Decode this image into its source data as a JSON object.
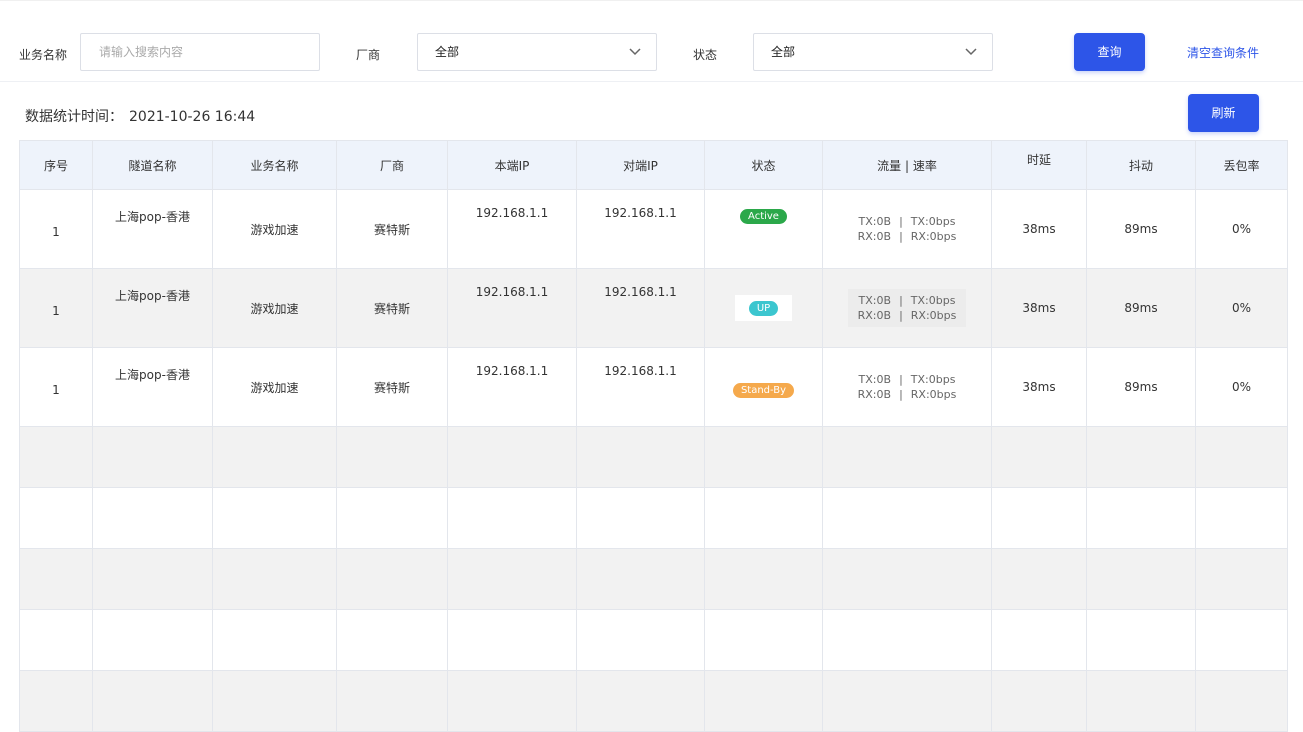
{
  "filters": {
    "business_name_label": "业务名称",
    "business_name_placeholder": "请输入搜索内容",
    "vendor_label": "厂商",
    "vendor_value": "全部",
    "status_label": "状态",
    "status_value": "全部",
    "query_button": "查询",
    "clear_link": "清空查询条件"
  },
  "stats": {
    "time_label": "数据统计时间：",
    "time_value": "2021-10-26 16:44",
    "refresh_button": "刷新"
  },
  "table": {
    "columns": [
      "序号",
      "隧道名称",
      "业务名称",
      "厂商",
      "本端IP",
      "对端IP",
      "状态",
      "流量 | 速率",
      "时延",
      "抖动",
      "丢包率"
    ],
    "rows": [
      {
        "index": "1",
        "tunnel": "上海pop-香港",
        "business": "游戏加速",
        "vendor": "赛特斯",
        "local_ip": "192.168.1.1",
        "peer_ip": "192.168.1.1",
        "status": "Active",
        "tx": "TX:0B",
        "tx_rate": "TX:0bps",
        "rx": "RX:0B",
        "rx_rate": "RX:0bps",
        "latency": "38ms",
        "jitter": "89ms",
        "loss": "0%"
      },
      {
        "index": "1",
        "tunnel": "上海pop-香港",
        "business": "游戏加速",
        "vendor": "赛特斯",
        "local_ip": "192.168.1.1",
        "peer_ip": "192.168.1.1",
        "status": "UP",
        "tx": "TX:0B",
        "tx_rate": "TX:0bps",
        "rx": "RX:0B",
        "rx_rate": "RX:0bps",
        "latency": "38ms",
        "jitter": "89ms",
        "loss": "0%"
      },
      {
        "index": "1",
        "tunnel": "上海pop-香港",
        "business": "游戏加速",
        "vendor": "赛特斯",
        "local_ip": "192.168.1.1",
        "peer_ip": "192.168.1.1",
        "status": "Stand-By",
        "tx": "TX:0B",
        "tx_rate": "TX:0bps",
        "rx": "RX:0B",
        "rx_rate": "RX:0bps",
        "latency": "38ms",
        "jitter": "89ms",
        "loss": "0%"
      }
    ],
    "status_colors": {
      "Active": "#2ba84a",
      "UP": "#3cc6cf",
      "Stand-By": "#f5a94c"
    },
    "header_bg": "#eef3fb",
    "accent": "#2d55e8"
  }
}
